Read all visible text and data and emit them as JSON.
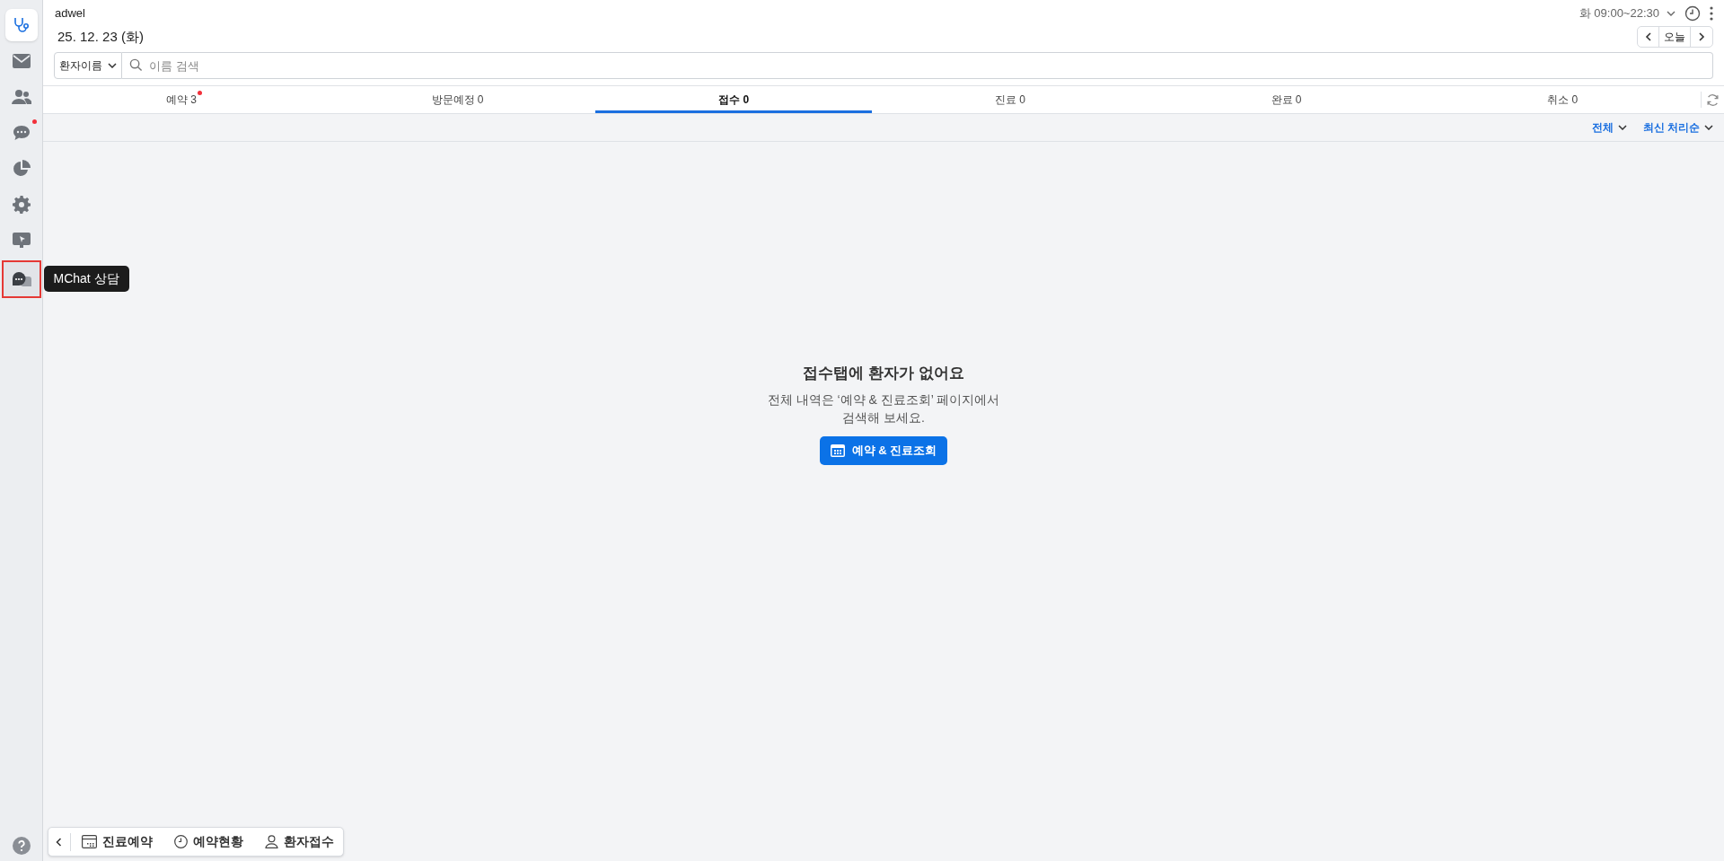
{
  "sidebar": {
    "items": [
      {
        "selected": true,
        "dot": false,
        "highlighted": false
      },
      {
        "selected": false,
        "dot": false,
        "highlighted": false
      },
      {
        "selected": false,
        "dot": false,
        "highlighted": false
      },
      {
        "selected": false,
        "dot": true,
        "highlighted": false
      },
      {
        "selected": false,
        "dot": false,
        "highlighted": false
      },
      {
        "selected": false,
        "dot": false,
        "highlighted": false
      },
      {
        "selected": false,
        "dot": false,
        "highlighted": false
      },
      {
        "selected": false,
        "dot": false,
        "highlighted": true
      }
    ],
    "tooltip": "MChat 상담"
  },
  "header": {
    "clinic": "adwel",
    "date": "25. 12. 23 (화)",
    "hours": "화 09:00~22:30",
    "today_button": "오늘"
  },
  "search": {
    "type_select": "환자이름",
    "placeholder": "이름 검색"
  },
  "tabs": [
    {
      "label": "예약 3",
      "selected": false,
      "dot": true
    },
    {
      "label": "방문예정 0",
      "selected": false,
      "dot": false
    },
    {
      "label": "접수 0",
      "selected": true,
      "dot": false
    },
    {
      "label": "진료 0",
      "selected": false,
      "dot": false
    },
    {
      "label": "완료 0",
      "selected": false,
      "dot": false
    },
    {
      "label": "취소 0",
      "selected": false,
      "dot": false
    }
  ],
  "filters": [
    "전체",
    "최신 처리순"
  ],
  "empty_state": {
    "title": "접수탭에 환자가 없어요",
    "message": "전체 내역은 ‘예약 & 진료조회’ 페이지에서\n검색해 보세요.",
    "button": "예약 & 진료조회"
  },
  "bottom_bar": [
    {
      "label": "진료예약"
    },
    {
      "label": "예약현황"
    },
    {
      "label": "환자접수"
    }
  ]
}
